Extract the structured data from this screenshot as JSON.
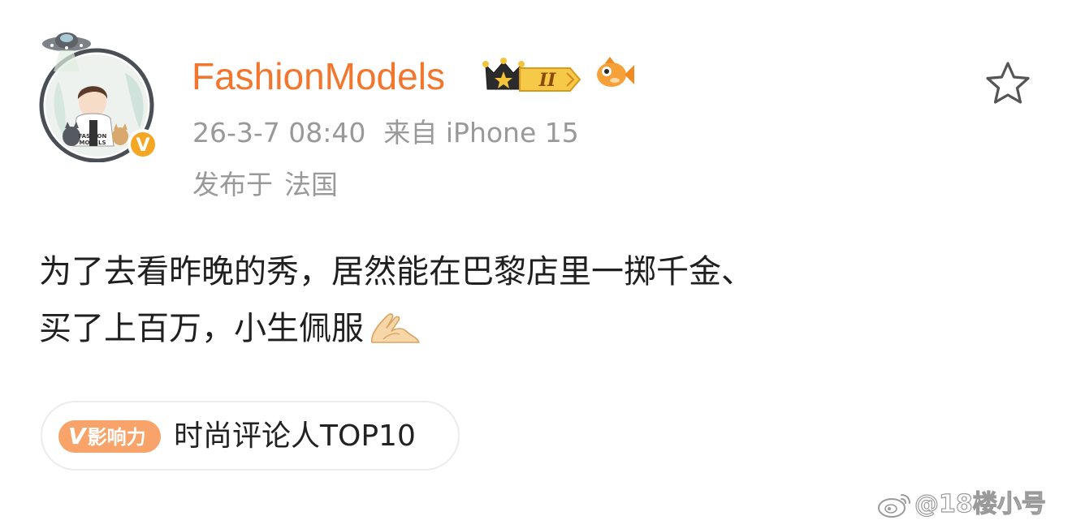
{
  "post": {
    "author": {
      "name": "FashionModels",
      "avatar_caption": "FASHION MODELS",
      "verified_badge": "V",
      "level_badge": "II"
    },
    "meta": {
      "time": "26-3-7 08:40",
      "source": "来自 iPhone 15",
      "location_label": "发布于",
      "location": "法国"
    },
    "content": {
      "line1": "为了去看昨晚的秀，居然能在巴黎店里一掷千金、",
      "line2": "买了上百万，小生佩服"
    },
    "influence": {
      "tag_mark": "V",
      "tag_label": "影响力",
      "title": "时尚评论人TOP10"
    }
  },
  "watermark": {
    "text": "@18楼小号"
  },
  "icons": {
    "favorite": "star-outline-icon",
    "emoji": "pressed-hands-emoji",
    "crown": "crown-icon",
    "fish": "fish-icon",
    "ufo": "ufo-icon",
    "weibo": "weibo-logo-icon"
  },
  "colors": {
    "username": "#f2762d",
    "meta": "#999999",
    "text": "#1f1f1f",
    "verified": "#f5a623",
    "influence_tag": "#f7a36a"
  }
}
